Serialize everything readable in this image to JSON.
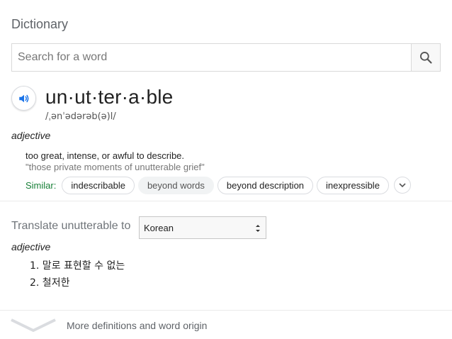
{
  "header": {
    "title": "Dictionary"
  },
  "search": {
    "placeholder": "Search for a word",
    "value": ""
  },
  "entry": {
    "headword": "un·ut·ter·a·ble",
    "phonetic": "/ˌənˈədərəb(ə)l/",
    "part_of_speech": "adjective",
    "definition": "too great, intense, or awful to describe.",
    "example": "\"those private moments of unutterable grief\"",
    "similar_label": "Similar:",
    "similar": [
      "indescribable",
      "beyond words",
      "beyond description",
      "inexpressible"
    ]
  },
  "translate": {
    "label": "Translate unutterable to",
    "selected_language": "Korean",
    "part_of_speech": "adjective",
    "translations": [
      "1. 말로 표현할 수 없는",
      "2. 철저한"
    ]
  },
  "footer": {
    "more_link": "More definitions and word origin"
  },
  "colors": {
    "accent": "#1a73e8",
    "similar_label": "#188038",
    "muted": "#5f6368"
  },
  "icons": {
    "search": "search-icon",
    "speaker": "speaker-icon",
    "expand": "chevron-down-icon"
  }
}
